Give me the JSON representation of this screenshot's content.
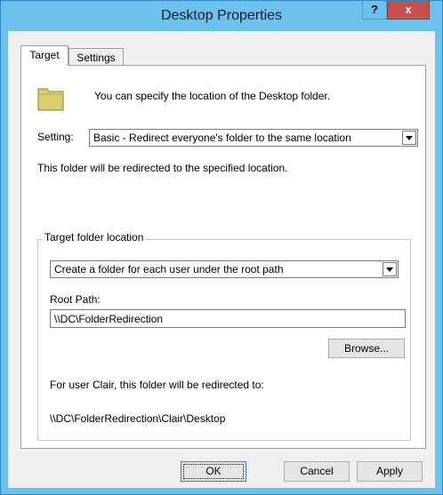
{
  "window": {
    "title": "Desktop Properties",
    "help_label": "?",
    "close_label": "x"
  },
  "tabs": [
    {
      "label": "Target",
      "selected": true
    },
    {
      "label": "Settings",
      "selected": false
    }
  ],
  "target": {
    "intro": "You can specify the location of the Desktop folder.",
    "setting_label": "Setting:",
    "setting_value": "Basic - Redirect everyone's folder to the same location",
    "redirect_text": "This folder will be redirected to the specified location.",
    "group_title": "Target folder location",
    "location_value": "Create a folder for each user under the root path",
    "root_path_label": "Root Path:",
    "root_path_value": "\\\\DC\\FolderRedirection",
    "browse_label": "Browse...",
    "for_user_text": "For user Clair, this folder will be redirected to:",
    "resolved_path": "\\\\DC\\FolderRedirection\\Clair\\Desktop"
  },
  "buttons": {
    "ok": "OK",
    "cancel": "Cancel",
    "apply": "Apply"
  },
  "icons": {
    "folder": "folder-icon",
    "dropdown": "chevron-down-icon"
  },
  "colors": {
    "titlebar": "#6cc1ee",
    "close_button": "#c7504b",
    "folder": "#d8d070"
  }
}
